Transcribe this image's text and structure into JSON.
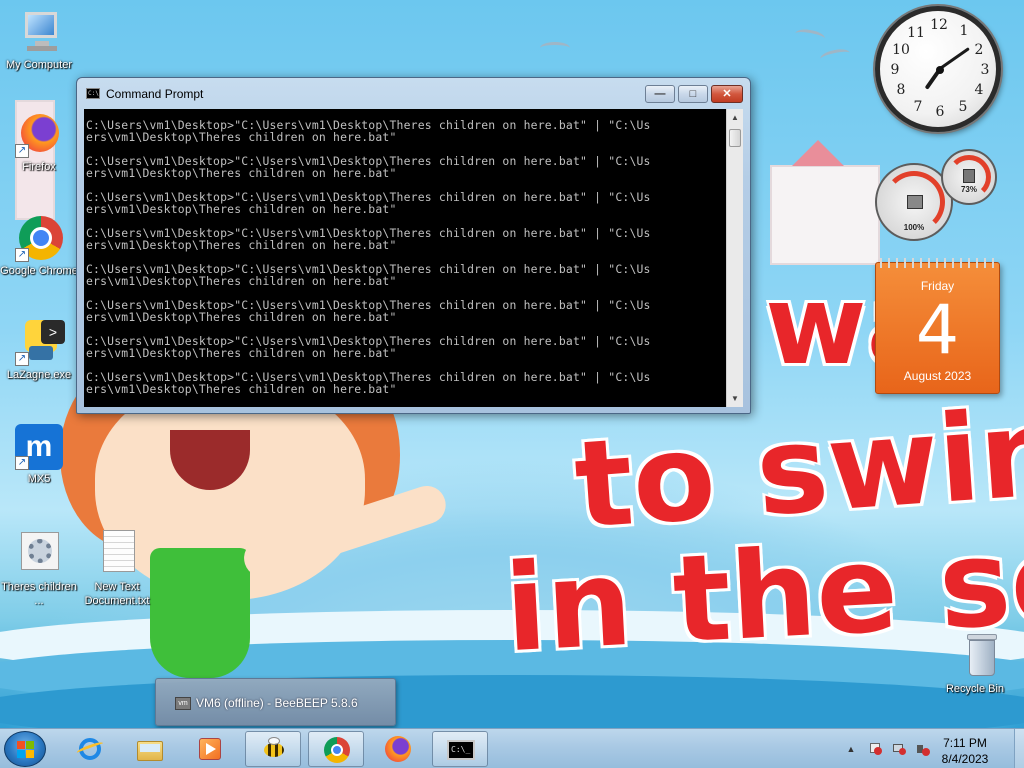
{
  "desktop": {
    "icons": [
      {
        "name": "my-computer",
        "label": "My Computer"
      },
      {
        "name": "firefox",
        "label": "Firefox"
      },
      {
        "name": "google-chrome",
        "label": "Google Chrome"
      },
      {
        "name": "lazagne",
        "label": "LaZagne.exe"
      },
      {
        "name": "mx5",
        "label": "MX5"
      },
      {
        "name": "theres-children",
        "label": "Theres children ..."
      },
      {
        "name": "new-text-document",
        "label": "New Text Document.txt"
      },
      {
        "name": "recycle-bin",
        "label": "Recycle Bin"
      }
    ],
    "wallpaper": {
      "line1": "wa",
      "line2": "to swin",
      "line3": "in the se"
    }
  },
  "cmd_window": {
    "title": "Command Prompt",
    "controls": {
      "minimize": "—",
      "maximize": "□",
      "close": "✕"
    },
    "lines": [
      {
        "a": "C:\\Users\\vm1\\Desktop>\"C:\\Users\\vm1\\Desktop\\Theres children on here.bat\" | \"C:\\Us",
        "b": "ers\\vm1\\Desktop\\Theres children on here.bat\""
      },
      {
        "a": "C:\\Users\\vm1\\Desktop>\"C:\\Users\\vm1\\Desktop\\Theres children on here.bat\" | \"C:\\Us",
        "b": "ers\\vm1\\Desktop\\Theres children on here.bat\""
      },
      {
        "a": "C:\\Users\\vm1\\Desktop>\"C:\\Users\\vm1\\Desktop\\Theres children on here.bat\" | \"C:\\Us",
        "b": "ers\\vm1\\Desktop\\Theres children on here.bat\""
      },
      {
        "a": "C:\\Users\\vm1\\Desktop>\"C:\\Users\\vm1\\Desktop\\Theres children on here.bat\" | \"C:\\Us",
        "b": "ers\\vm1\\Desktop\\Theres children on here.bat\""
      },
      {
        "a": "C:\\Users\\vm1\\Desktop>\"C:\\Users\\vm1\\Desktop\\Theres children on here.bat\" | \"C:\\Us",
        "b": "ers\\vm1\\Desktop\\Theres children on here.bat\""
      },
      {
        "a": "C:\\Users\\vm1\\Desktop>\"C:\\Users\\vm1\\Desktop\\Theres children on here.bat\" | \"C:\\Us",
        "b": "ers\\vm1\\Desktop\\Theres children on here.bat\""
      },
      {
        "a": "C:\\Users\\vm1\\Desktop>\"C:\\Users\\vm1\\Desktop\\Theres children on here.bat\" | \"C:\\Us",
        "b": "ers\\vm1\\Desktop\\Theres children on here.bat\""
      },
      {
        "a": "C:\\Users\\vm1\\Desktop>\"C:\\Users\\vm1\\Desktop\\Theres children on here.bat\" | \"C:\\Us",
        "b": "ers\\vm1\\Desktop\\Theres children on here.bat\""
      }
    ]
  },
  "gadgets": {
    "clock_numbers": [
      "12",
      "1",
      "2",
      "3",
      "4",
      "5",
      "6",
      "7",
      "8",
      "9",
      "10",
      "11"
    ],
    "cpu": {
      "cpu_percent": "100%",
      "memory_percent": "73%"
    },
    "calendar": {
      "weekday": "Friday",
      "day": "4",
      "month_year": "August 2023"
    }
  },
  "taskbar": {
    "popup": {
      "title": "VM6 (offline) - BeeBEEP 5.8.6",
      "icon": "vm"
    },
    "clock": {
      "time": "7:11 PM",
      "date": "8/4/2023"
    },
    "tray": {
      "show_hidden": "▲"
    },
    "colors": {
      "accent": "#2a78c2"
    }
  }
}
